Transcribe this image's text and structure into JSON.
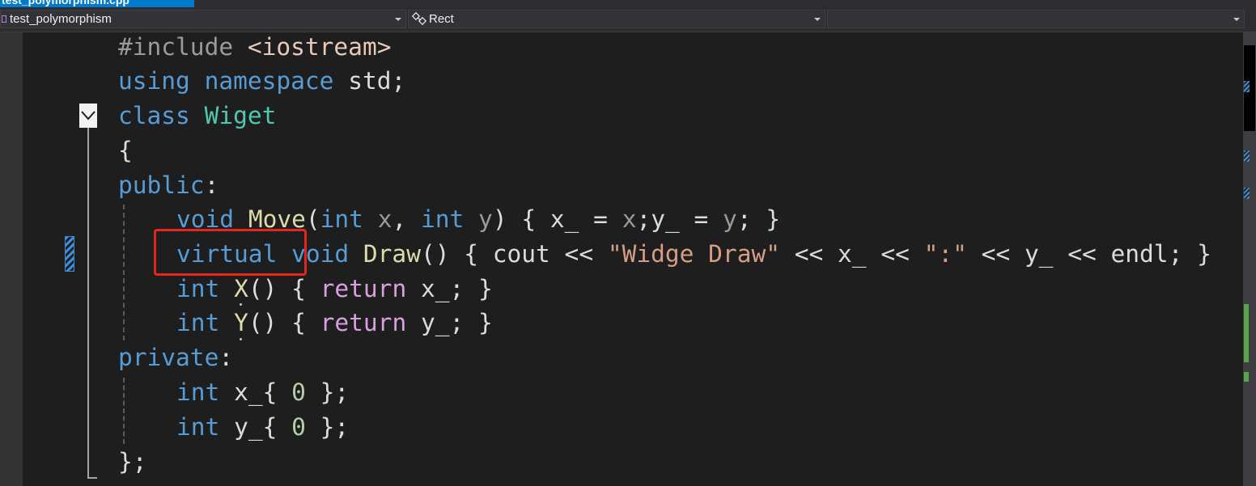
{
  "file_tab": {
    "label": "test_polymorphism.cpp"
  },
  "navbar": {
    "project": "test_polymorphism",
    "scope": "Rect",
    "member": ""
  },
  "code": {
    "l1": {
      "directive": "#include",
      "header": "<iostream>"
    },
    "l2": {
      "kw_using": "using",
      "kw_namespace": "namespace",
      "ns": "std",
      "semi": ";"
    },
    "l3": {
      "kw_class": "class",
      "name": "Wiget"
    },
    "l4": {
      "brace": "{"
    },
    "l5": {
      "access": "public",
      "colon": ":"
    },
    "l6": {
      "ret": "void",
      "fn": "Move",
      "open": "(",
      "t1": "int",
      "p1": "x",
      "comma": ", ",
      "t2": "int",
      "p2": "y",
      "body1": ") { ",
      "f1": "x_",
      "eq1": " = ",
      "v1": "x",
      "sep": ";",
      "f2": "y_",
      "eq2": " = ",
      "v2": "y",
      "end": "; }"
    },
    "l7": {
      "kw_virtual": "virtual",
      "ret": "void",
      "fn": "Draw",
      "body1": "() { cout << ",
      "s1": "\"Widge Draw\"",
      "op1": " << ",
      "f1": "x_",
      "op2": " << ",
      "s2": "\":\"",
      "op3": " << ",
      "f2": "y_",
      "op4": " << endl; }"
    },
    "l8": {
      "t": "int",
      "fn": "X",
      "body1": "() { ",
      "ret": "return",
      "f": "x_",
      "end": "; }"
    },
    "l9": {
      "t": "int",
      "fn": "Y",
      "body1": "() { ",
      "ret": "return",
      "f": "y_",
      "end": "; }"
    },
    "l10": {
      "access": "private",
      "colon": ":"
    },
    "l11": {
      "t": "int",
      "f": "x_",
      "open": "{ ",
      "n": "0",
      "end": " };"
    },
    "l12": {
      "t": "int",
      "f": "y_",
      "open": "{ ",
      "n": "0",
      "end": " };"
    },
    "l13": {
      "close": "};"
    }
  },
  "colors": {
    "keyword": "#569cd6",
    "control_keyword": "#d8a0df",
    "type_name": "#4ec9b0",
    "function": "#dcdcaa",
    "string": "#d69d85",
    "number": "#b5cea8",
    "highlight_box": "#e4261d",
    "change_marker": "#3c8dd8"
  }
}
